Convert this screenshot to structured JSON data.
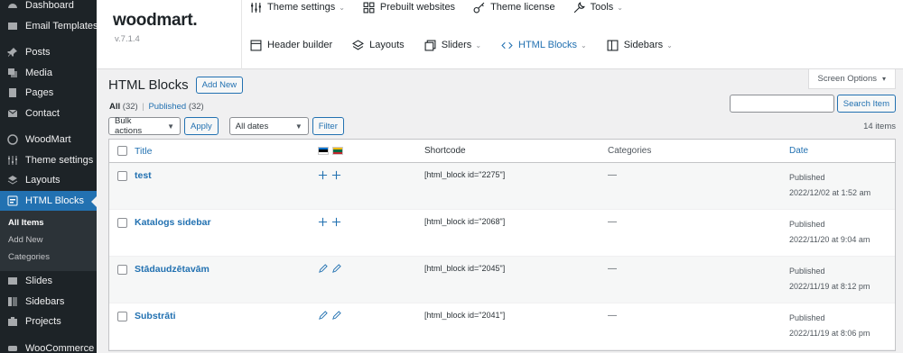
{
  "sidebar": {
    "items_top": [
      {
        "label": "Dashboard",
        "icon": "dashboard-icon"
      },
      {
        "label": "Email Templates",
        "icon": "email-icon"
      }
    ],
    "items": [
      {
        "label": "Posts",
        "icon": "pin-icon"
      },
      {
        "label": "Media",
        "icon": "media-icon"
      },
      {
        "label": "Pages",
        "icon": "pages-icon"
      },
      {
        "label": "Contact",
        "icon": "mail-icon"
      }
    ],
    "items2": [
      {
        "label": "WoodMart",
        "icon": "woodmart-icon"
      },
      {
        "label": "Theme settings",
        "icon": "sliders-icon"
      },
      {
        "label": "Layouts",
        "icon": "layers-icon"
      },
      {
        "label": "HTML Blocks",
        "icon": "blocks-icon"
      }
    ],
    "submenu": [
      "All Items",
      "Add New",
      "Categories"
    ],
    "items3": [
      {
        "label": "Slides",
        "icon": "slides-icon"
      },
      {
        "label": "Sidebars",
        "icon": "sidebars-icon"
      },
      {
        "label": "Projects",
        "icon": "projects-icon"
      }
    ],
    "items4": [
      {
        "label": "WooCommerce",
        "icon": "woocommerce-icon"
      }
    ]
  },
  "topbar": {
    "logo": "woodmart.",
    "version": "v.7.1.4",
    "menu1": [
      "Theme settings",
      "Prebuilt websites",
      "Theme license",
      "Tools"
    ],
    "menu2": [
      "Header builder",
      "Layouts",
      "Sliders",
      "HTML Blocks",
      "Sidebars"
    ]
  },
  "screen_options": "Screen Options",
  "page": {
    "title": "HTML Blocks",
    "add_new": "Add New",
    "filter_all": "All",
    "filter_all_count": "(32)",
    "filter_sep": "|",
    "filter_published": "Published",
    "filter_published_count": "(32)",
    "search_button": "Search Item",
    "bulk_actions": "Bulk actions",
    "apply": "Apply",
    "all_dates": "All dates",
    "filter": "Filter",
    "items_count": "14 items"
  },
  "table": {
    "columns": {
      "title": "Title",
      "shortcode": "Shortcode",
      "categories": "Categories",
      "date": "Date"
    },
    "rows": [
      {
        "title": "test",
        "lang_icon": "plus-icon",
        "shortcode": "[html_block id=\"2275\"]",
        "categories": "—",
        "status": "Published",
        "date": "2022/12/02 at 1:52 am"
      },
      {
        "title": "Katalogs sidebar",
        "lang_icon": "plus-icon",
        "shortcode": "[html_block id=\"2068\"]",
        "categories": "—",
        "status": "Published",
        "date": "2022/11/20 at 9:04 am"
      },
      {
        "title": "Stādaudzētavām",
        "lang_icon": "pencil-icon",
        "shortcode": "[html_block id=\"2045\"]",
        "categories": "—",
        "status": "Published",
        "date": "2022/11/19 at 8:12 pm"
      },
      {
        "title": "Substrāti",
        "lang_icon": "pencil-icon",
        "shortcode": "[html_block id=\"2041\"]",
        "categories": "—",
        "status": "Published",
        "date": "2022/11/19 at 8:06 pm"
      }
    ]
  }
}
